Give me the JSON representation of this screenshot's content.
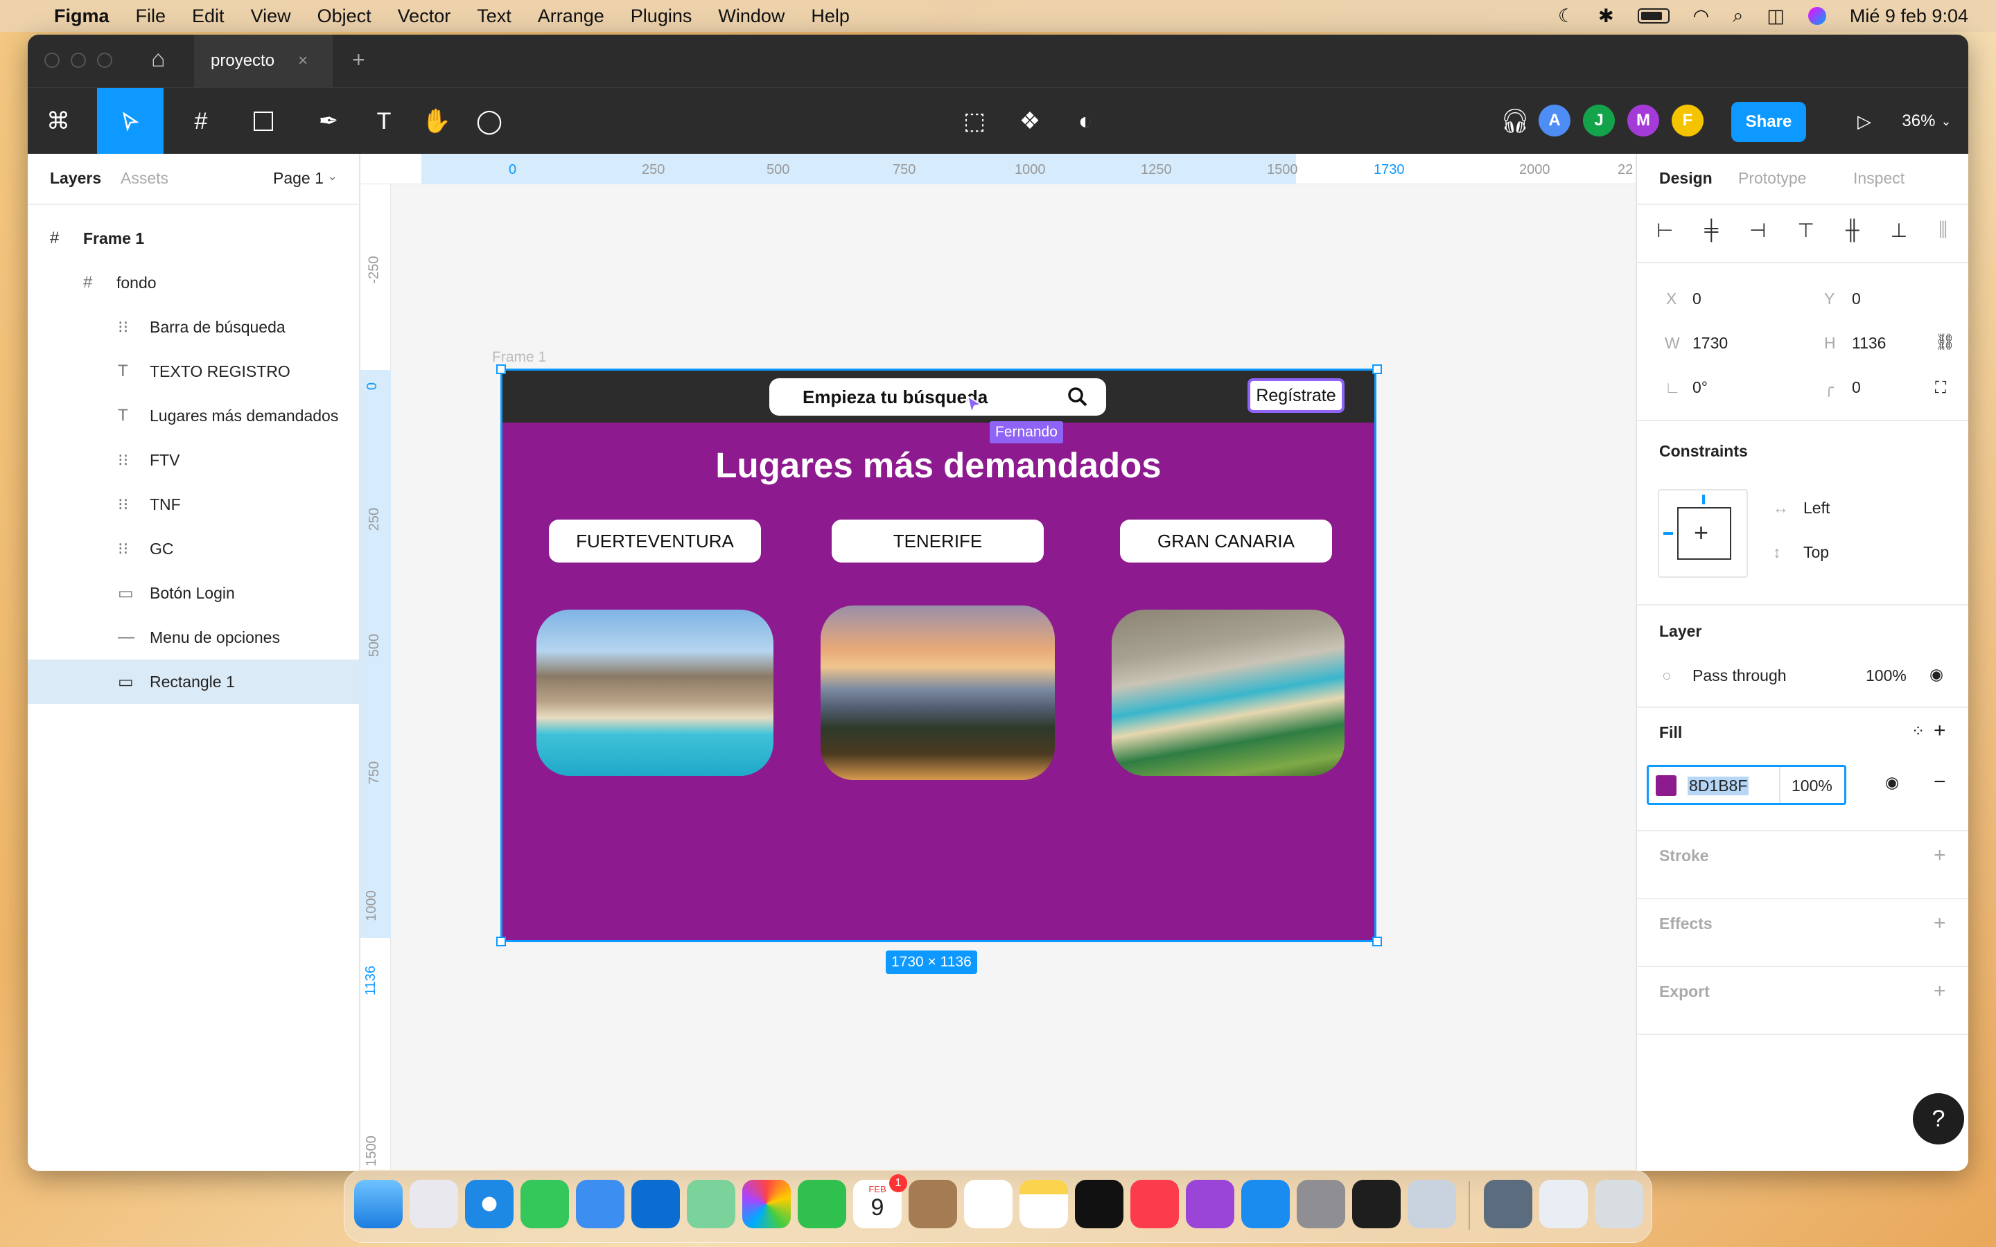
{
  "menubar": {
    "app": "Figma",
    "items": [
      "File",
      "Edit",
      "View",
      "Object",
      "Vector",
      "Text",
      "Arrange",
      "Plugins",
      "Window",
      "Help"
    ],
    "datetime": "Mié 9 feb  9:04"
  },
  "tab": {
    "title": "proyecto"
  },
  "toolbar": {
    "avatars": [
      "A",
      "J",
      "M",
      "F"
    ],
    "avatar_colors": [
      "#4e8df5",
      "#13a34a",
      "#a43bd8",
      "#f5c400"
    ],
    "share_label": "Share",
    "zoom": "36%"
  },
  "left_panel": {
    "tabs": [
      "Layers",
      "Assets"
    ],
    "page": "Page 1",
    "layers": [
      {
        "name": "Frame 1"
      },
      {
        "name": "fondo"
      },
      {
        "name": "Barra de búsqueda"
      },
      {
        "name": "TEXTO REGISTRO"
      },
      {
        "name": "Lugares más demandados"
      },
      {
        "name": "FTV"
      },
      {
        "name": "TNF"
      },
      {
        "name": "GC"
      },
      {
        "name": "Botón Login"
      },
      {
        "name": "Menu de opciones"
      },
      {
        "name": "Rectangle 1"
      }
    ]
  },
  "rulers": {
    "top": [
      "0",
      "250",
      "500",
      "750",
      "1000",
      "1250",
      "1500",
      "1730",
      "2000",
      "22"
    ],
    "left": [
      "-250",
      "0",
      "250",
      "500",
      "750",
      "1000",
      "1136",
      "1500"
    ]
  },
  "canvas": {
    "frame_label": "Frame 1",
    "size_badge": "1730 × 1136",
    "cursor_user": "Fernando",
    "design": {
      "search_text": "Empieza tu búsqueda",
      "register": "Regístrate",
      "heading": "Lugares más demandados",
      "places": [
        "FUERTEVENTURA",
        "TENERIFE",
        "GRAN CANARIA"
      ],
      "background_color": "#8D1B8F"
    }
  },
  "right_panel": {
    "tabs": [
      "Design",
      "Prototype",
      "Inspect"
    ],
    "x_label": "X",
    "x": "0",
    "y_label": "Y",
    "y": "0",
    "w_label": "W",
    "w": "1730",
    "h_label": "H",
    "h": "1136",
    "rotation": "0°",
    "radius": "0",
    "constraints_title": "Constraints",
    "constraint_h": "Left",
    "constraint_v": "Top",
    "layer_title": "Layer",
    "blend": "Pass through",
    "opacity": "100%",
    "fill_title": "Fill",
    "fill_hex": "8D1B8F",
    "fill_opacity": "100%",
    "stroke_title": "Stroke",
    "effects_title": "Effects",
    "export_title": "Export",
    "help": "?"
  },
  "dock": {
    "calendar_month": "FEB",
    "calendar_day": "9",
    "badge": "1"
  }
}
